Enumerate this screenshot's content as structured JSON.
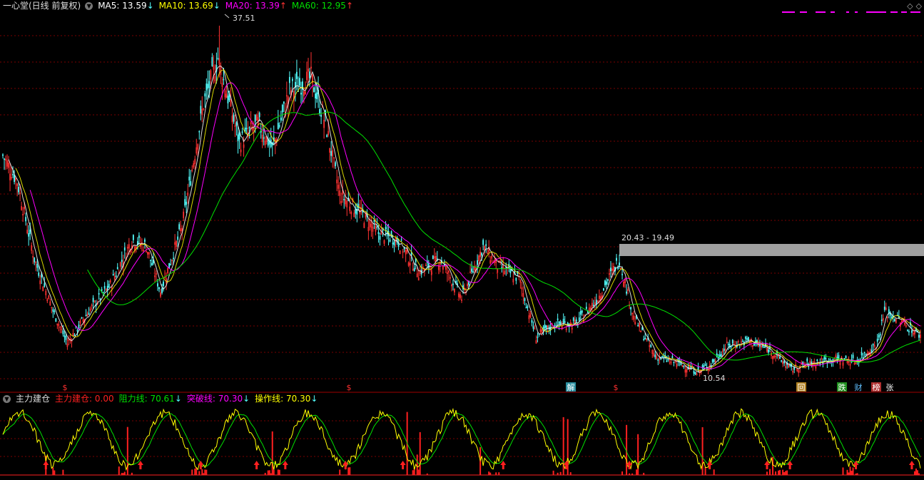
{
  "main": {
    "stock_title": "一心堂(日线 前复权)",
    "ma": [
      {
        "label": "MA5: 13.59",
        "arrow": "↓",
        "color": "#ffffff"
      },
      {
        "label": "MA10: 13.69",
        "arrow": "↓",
        "color": "#ffff00"
      },
      {
        "label": "MA20: 13.39",
        "arrow": "↑",
        "color": "#ff00ff"
      },
      {
        "label": "MA60: 12.95",
        "arrow": "↑",
        "color": "#00e000"
      }
    ],
    "high_label": "37.51",
    "low_label": "10.54",
    "range_label": "20.43 - 19.49",
    "controls": [
      "◇",
      "◇"
    ]
  },
  "sub": {
    "indicator_name": "主力建仓",
    "items": [
      {
        "label": "主力建仓: 0.00",
        "arrow": "",
        "color": "#ff2020"
      },
      {
        "label": "阻力线: 70.61",
        "arrow": "↓",
        "color": "#00e000"
      },
      {
        "label": "突破线: 70.30",
        "arrow": "↓",
        "color": "#ff00ff"
      },
      {
        "label": "操作线: 70.30",
        "arrow": "↓",
        "color": "#ffff00"
      }
    ]
  },
  "markers": [
    {
      "text": "$",
      "color": "#ff3030",
      "box": ""
    },
    {
      "text": "$",
      "color": "#ff3030",
      "box": ""
    },
    {
      "text": "解",
      "color": "#ffffff",
      "box": "#2a8fa0"
    },
    {
      "text": "$",
      "color": "#ff3030",
      "box": ""
    },
    {
      "text": "回",
      "color": "#ffffff",
      "box": "#b08020"
    },
    {
      "text": "跌",
      "color": "#ffffff",
      "box": "#209020"
    },
    {
      "text": "财",
      "color": "#60c0ff",
      "box": ""
    },
    {
      "text": "榜",
      "color": "#ffffff",
      "box": "#b03030"
    },
    {
      "text": "张",
      "color": "#ffffff",
      "box": ""
    }
  ],
  "colors": {
    "up": "#ff3232",
    "down": "#54ffff",
    "grid": "#7a0000",
    "range_band": "#a0a0a0"
  },
  "chart_data": [
    {
      "type": "candlestick",
      "ylim": [
        9.5,
        38.5
      ],
      "close_anchors": [
        [
          0,
          27.5
        ],
        [
          10,
          25.5
        ],
        [
          22,
          19.5
        ],
        [
          35,
          15.5
        ],
        [
          45,
          13.0
        ],
        [
          60,
          15.5
        ],
        [
          75,
          17.5
        ],
        [
          90,
          21.0
        ],
        [
          100,
          20.5
        ],
        [
          110,
          17.0
        ],
        [
          125,
          22.0
        ],
        [
          140,
          31.5
        ],
        [
          150,
          35.0
        ],
        [
          165,
          28.5
        ],
        [
          178,
          30.0
        ],
        [
          188,
          28.0
        ],
        [
          200,
          32.5
        ],
        [
          215,
          33.5
        ],
        [
          225,
          30.0
        ],
        [
          235,
          24.5
        ],
        [
          250,
          23.0
        ],
        [
          262,
          21.5
        ],
        [
          275,
          21.0
        ],
        [
          290,
          18.5
        ],
        [
          305,
          19.5
        ],
        [
          320,
          16.5
        ],
        [
          335,
          20.5
        ],
        [
          345,
          19.0
        ],
        [
          360,
          18.0
        ],
        [
          372,
          13.5
        ],
        [
          385,
          14.5
        ],
        [
          400,
          14.5
        ],
        [
          415,
          16.5
        ],
        [
          425,
          18.5
        ],
        [
          430,
          19.5
        ],
        [
          440,
          15.0
        ],
        [
          455,
          12.0
        ],
        [
          470,
          11.5
        ],
        [
          485,
          10.8
        ],
        [
          495,
          11.5
        ],
        [
          505,
          12.8
        ],
        [
          520,
          13.2
        ],
        [
          535,
          12.5
        ],
        [
          550,
          11.0
        ],
        [
          565,
          11.5
        ],
        [
          580,
          11.8
        ],
        [
          595,
          11.6
        ],
        [
          610,
          13.0
        ],
        [
          615,
          15.5
        ],
        [
          625,
          14.8
        ],
        [
          640,
          13.59
        ]
      ],
      "count": 641,
      "high": 37.51,
      "low": 10.54,
      "band": [
        19.49,
        20.43
      ],
      "ma_periods": [
        5,
        10,
        20,
        60
      ]
    },
    {
      "type": "bar+line",
      "ylim": [
        0,
        100
      ],
      "lines": [
        "阻力线",
        "突破线",
        "操作线"
      ],
      "bars": "主力建仓"
    }
  ]
}
